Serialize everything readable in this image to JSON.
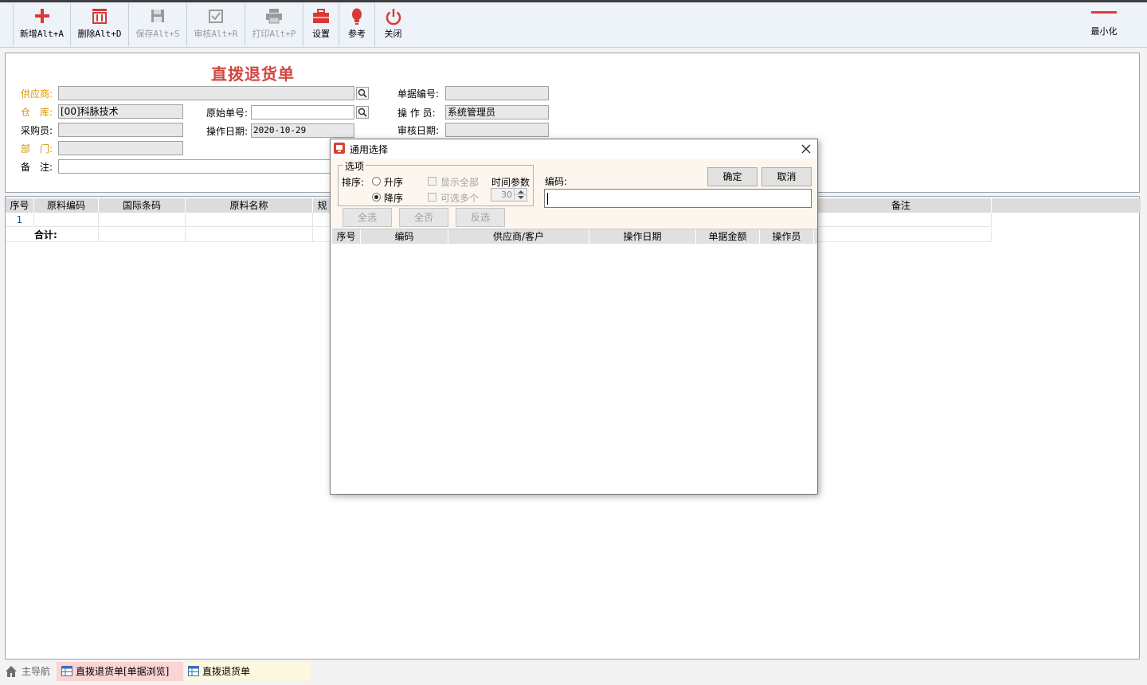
{
  "toolbar": {
    "buttons": [
      {
        "label": "新增Alt+A",
        "icon": "plus-icon",
        "enabled": true
      },
      {
        "label": "删除Alt+D",
        "icon": "trash-icon",
        "enabled": true
      },
      {
        "label": "保存Alt+S",
        "icon": "save-icon",
        "enabled": false
      },
      {
        "label": "审核Alt+R",
        "icon": "approve-icon",
        "enabled": false
      },
      {
        "label": "打印Alt+P",
        "icon": "print-icon",
        "enabled": false
      },
      {
        "label": "设置",
        "icon": "toolbox-icon",
        "enabled": true
      },
      {
        "label": "参考",
        "icon": "bulb-icon",
        "enabled": true
      },
      {
        "label": "关闭",
        "icon": "power-icon",
        "enabled": true
      }
    ],
    "minimize_label": "最小化"
  },
  "form": {
    "title": "直拨退货单",
    "supplier_label": "供应商:",
    "supplier_value": "",
    "warehouse_label": "仓　库:",
    "warehouse_value": "[00]科脉技术",
    "buyer_label": "采购员:",
    "buyer_value": "",
    "dept_label": "部　门:",
    "dept_value": "",
    "remark_label": "备　注:",
    "remark_value": "",
    "orig_no_label": "原始单号:",
    "orig_no_value": "",
    "op_date_label": "操作日期:",
    "op_date_value": "2020-10-29",
    "doc_no_label": "单据编号:",
    "doc_no_value": "",
    "operator_label": "操 作 员:",
    "operator_value": "系统管理员",
    "audit_date_label": "审核日期:",
    "audit_date_value": ""
  },
  "grid": {
    "columns": [
      "序号",
      "原料编码",
      "国际条码",
      "原料名称",
      "规",
      "备注"
    ],
    "rows": [
      {
        "index": "1"
      }
    ],
    "total_label": "合计:"
  },
  "tabs": [
    {
      "label": "主导航",
      "icon": "home-icon"
    },
    {
      "label": "直拨退货单[单据浏览]",
      "icon": "table-icon"
    },
    {
      "label": "直拨退货单",
      "icon": "table-icon"
    }
  ],
  "dialog": {
    "title": "通用选择",
    "options_legend": "选项",
    "sort_label": "排序:",
    "asc_label": "升序",
    "desc_label": "降序",
    "sort_selected": "降序",
    "show_all_label": "显示全部",
    "multi_select_label": "可选多个",
    "time_param_label": "时间参数",
    "time_param_value": "30",
    "code_label": "编码:",
    "code_value": "",
    "ok_label": "确定",
    "cancel_label": "取消",
    "select_all_label": "全选",
    "select_none_label": "全否",
    "invert_label": "反选",
    "columns": [
      "序号",
      "编码",
      "供应商/客户",
      "操作日期",
      "单据金额",
      "操作员"
    ]
  },
  "colors": {
    "accent_red": "#d0463f",
    "label_orange": "#d99400",
    "toolbar_bg": "#eef3fa",
    "dialog_opts_bg": "#fdf6ee"
  }
}
